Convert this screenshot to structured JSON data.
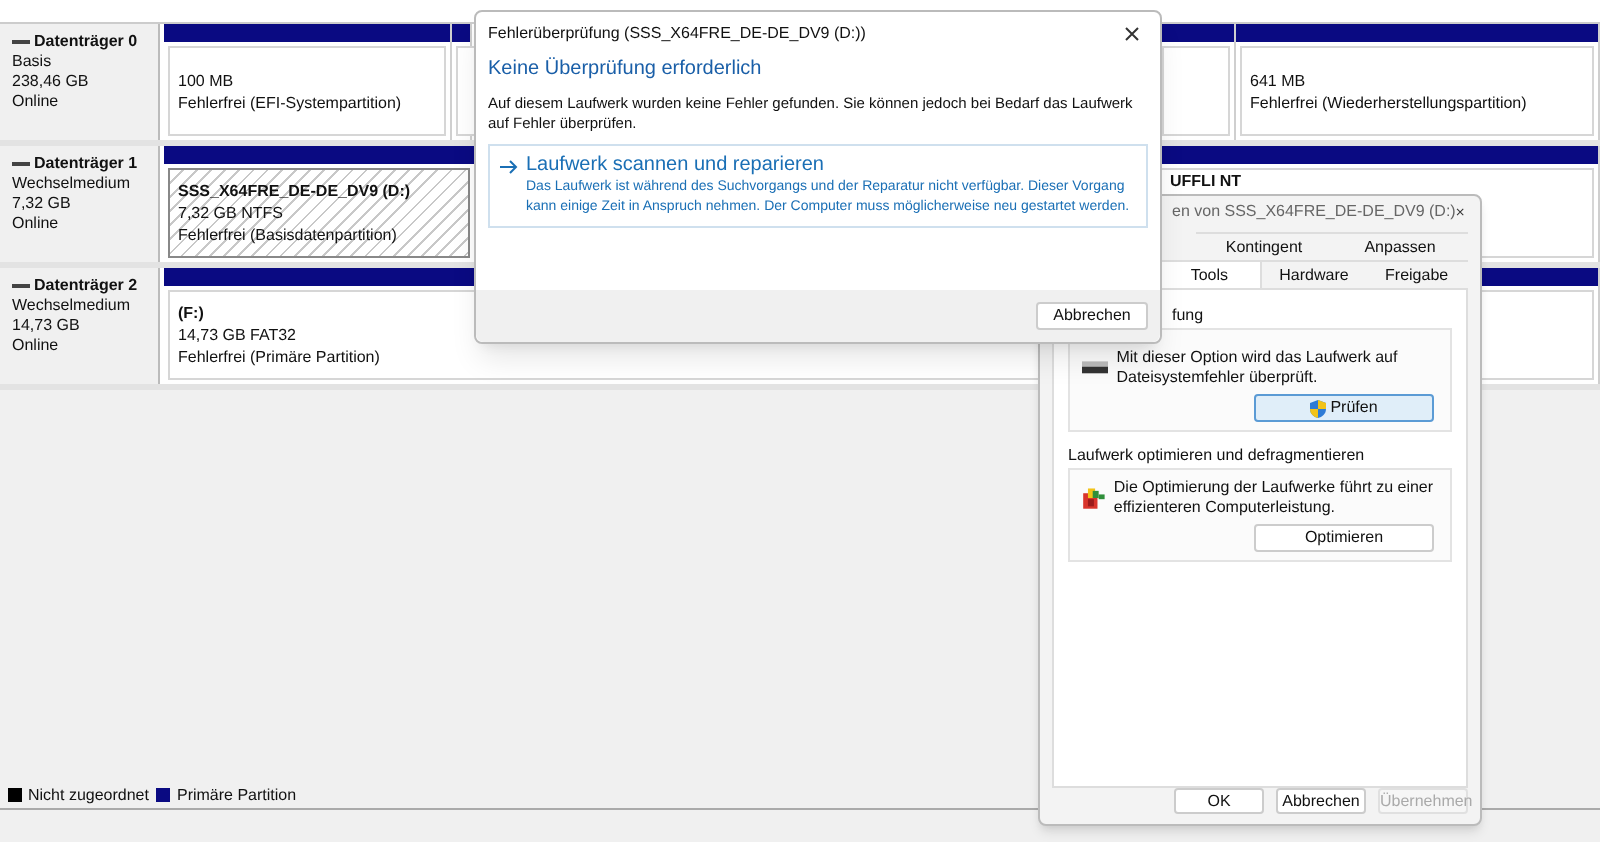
{
  "disks": [
    {
      "name": "Datenträger 0",
      "type": "Basis",
      "size": "238,46 GB",
      "status": "Online",
      "partitions": [
        {
          "kind": "normal",
          "lines": [
            "100 MB",
            "Fehlerfrei (EFI-Systempartition)"
          ]
        },
        {
          "kind": "normal"
        },
        {
          "kind": "hidden"
        },
        {
          "kind": "normal"
        },
        {
          "kind": "normal",
          "lines": [
            "641 MB",
            "Fehlerfrei (Wiederherstellungspartition)"
          ]
        }
      ]
    },
    {
      "name": "Datenträger 1",
      "type": "Wechselmedium",
      "size": "7,32 GB",
      "status": "Online",
      "partitions": [
        {
          "kind": "hatched",
          "title": "SSS_X64FRE_DE-DE_DV9  (D:)",
          "lines": [
            "7,32 GB NTFS",
            "Fehlerfrei (Basisdatenpartition)"
          ]
        },
        {
          "kind": "hidden"
        },
        {
          "kind": "normal",
          "title": "UFFLI NT"
        }
      ]
    },
    {
      "name": "Datenträger 2",
      "type": "Wechselmedium",
      "size": "14,73 GB",
      "status": "Online",
      "partitions": [
        {
          "kind": "normal",
          "title": "(F:)",
          "lines": [
            "14,73 GB FAT32",
            "Fehlerfrei (Primäre Partition)"
          ]
        }
      ]
    }
  ],
  "legend": [
    {
      "label": "Nicht zugeordnet",
      "color": "#000000"
    },
    {
      "label": "Primäre Partition",
      "color": "#0a0a82"
    }
  ],
  "check_dialog": {
    "title": "Fehlerüberprüfung (SSS_X64FRE_DE-DE_DV9 (D:))",
    "heading": "Keine Überprüfung erforderlich",
    "message": "Auf diesem Laufwerk wurden keine Fehler gefunden. Sie können jedoch bei Bedarf das Laufwerk auf Fehler überprüfen.",
    "action": {
      "title": "Laufwerk scannen und reparieren",
      "description": "Das Laufwerk ist während des Suchvorgangs und der Reparatur nicht verfügbar. Dieser Vorgang kann einige Zeit in Anspruch nehmen. Der Computer muss möglicherweise neu gestartet werden."
    },
    "buttons": [
      "Abbrechen"
    ]
  },
  "properties_dialog": {
    "title": "en von SSS_X64FRE_DE-DE_DV9 (D:)",
    "tab_rows": [
      [
        {
          "label": "Kontingent",
          "selected": false
        },
        {
          "label": "Anpassen",
          "selected": false
        }
      ],
      [
        {
          "label": "Tools",
          "selected": true
        },
        {
          "label": "Hardware",
          "selected": false
        },
        {
          "label": "Freigabe",
          "selected": false
        }
      ]
    ],
    "groups": [
      {
        "kind": "check",
        "title": "fung",
        "text": "Mit dieser Option wird das Laufwerk auf Dateisystemfehler überprüft.",
        "button": "Prüfen"
      },
      {
        "kind": "defrag",
        "title": "Laufwerk optimieren und defragmentieren",
        "text": "Die Optimierung der Laufwerke führt zu einer effizienteren Computerleistung.",
        "button": "Optimieren"
      }
    ],
    "buttons": [
      {
        "label": "OK",
        "disabled": false
      },
      {
        "label": "Abbrechen",
        "disabled": false
      },
      {
        "label": "Übernehmen",
        "disabled": true
      }
    ]
  }
}
